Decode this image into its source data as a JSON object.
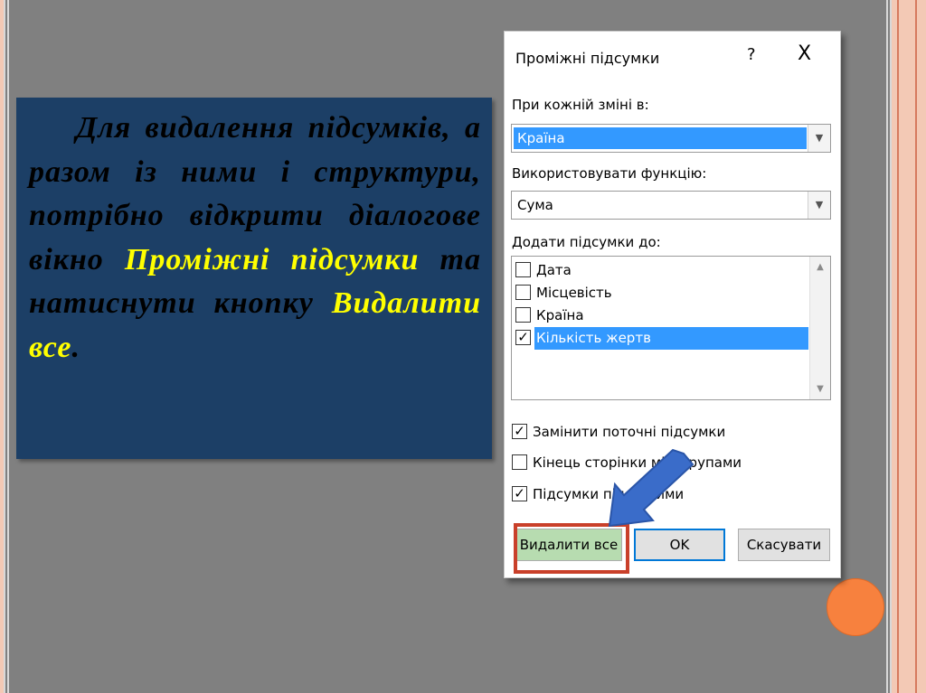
{
  "slide": {
    "text_part1": "Для видалення підсумків, а разом із ними і структури, потрібно відкрити діалогове вікно ",
    "highlight1": "Проміжні підсумки",
    "text_part2": " та натиснути кнопку ",
    "highlight2": "Видалити все",
    "text_end": "."
  },
  "dialog": {
    "title": "Проміжні підсумки",
    "help": "?",
    "close": "X",
    "group_by_label": "При кожній зміні в:",
    "group_by_value": "Країна",
    "function_label": "Використовувати функцію:",
    "function_value": "Сума",
    "add_to_label": "Додати підсумки до:",
    "fields": [
      {
        "label": "Дата",
        "checked": false
      },
      {
        "label": "Місцевість",
        "checked": false
      },
      {
        "label": "Країна",
        "checked": false
      },
      {
        "label": "Кількість жертв",
        "checked": true
      }
    ],
    "options": [
      {
        "label": "Замінити поточні підсумки",
        "checked": true
      },
      {
        "label": "Кінець сторінки між групами",
        "checked": false
      },
      {
        "label": "Підсумки під даними",
        "checked": true
      }
    ],
    "buttons": {
      "remove_all": "Видалити все",
      "ok": "OK",
      "cancel": "Скасувати"
    }
  },
  "colors": {
    "panel_bg": "#1c3f66",
    "highlight": "#ffff00",
    "selection": "#3399ff",
    "accent_red": "#c9402a",
    "arrow_blue": "#3a6cc9"
  }
}
